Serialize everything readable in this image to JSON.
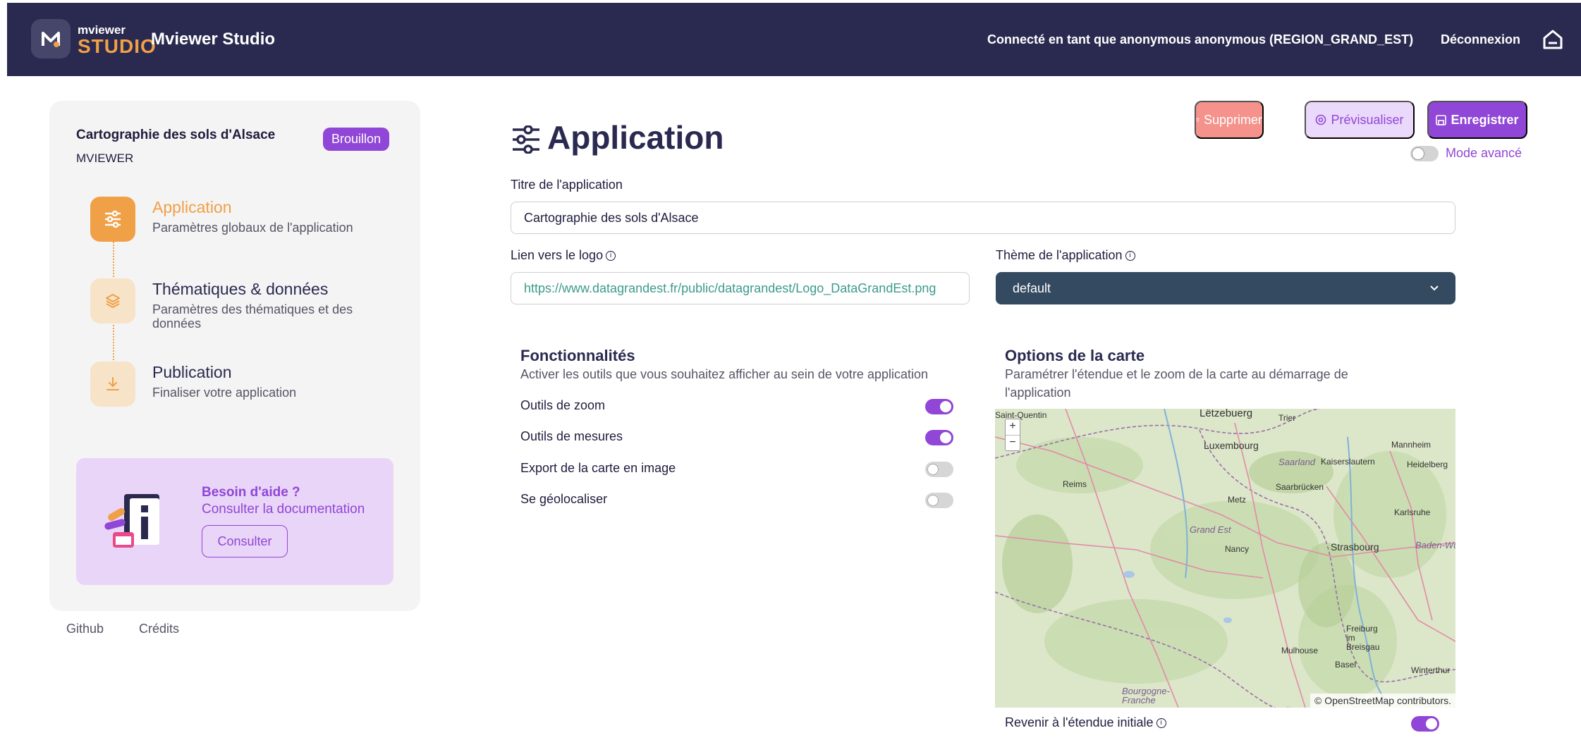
{
  "header": {
    "logo_small": "mviewer",
    "logo_big": "STUDIO",
    "app_name": "Mviewer Studio",
    "connected_as": "Connecté en tant que anonymous anonymous (REGION_GRAND_EST)",
    "logout": "Déconnexion",
    "home_icon": "home-icon"
  },
  "sidebar": {
    "project_title": "Cartographie des sols d'Alsace",
    "project_type": "MVIEWER",
    "status_badge": "Brouillon",
    "steps": [
      {
        "title": "Application",
        "description": "Paramètres globaux de l'application",
        "icon": "sliders-icon",
        "active": true
      },
      {
        "title": "Thématiques & données",
        "description": "Paramètres des thématiques et des données",
        "icon": "layers-icon",
        "active": false
      },
      {
        "title": "Publication",
        "description": "Finaliser votre application",
        "icon": "download-icon",
        "active": false
      }
    ],
    "help": {
      "title": "Besoin d'aide ?",
      "subtitle": "Consulter la documentation",
      "button": "Consulter"
    },
    "footer_links": [
      "Github",
      "Crédits"
    ]
  },
  "main": {
    "page_title": "Application",
    "actions": {
      "delete": "Supprimer",
      "preview": "Prévisualiser",
      "save": "Enregistrer"
    },
    "advanced_mode": {
      "label": "Mode avancé",
      "enabled": false
    },
    "form": {
      "title_label": "Titre de l'application",
      "title_value": "Cartographie des sols d'Alsace",
      "logo_label": "Lien vers le logo",
      "logo_value": "https://www.datagrandest.fr/public/datagrandest/Logo_DataGrandEst.png",
      "theme_label": "Thème de l'application",
      "theme_value": "default"
    },
    "features": {
      "title": "Fonctionnalités",
      "description": "Activer les outils que vous souhaitez afficher au sein de votre application",
      "items": [
        {
          "label": "Outils de zoom",
          "enabled": true
        },
        {
          "label": "Outils de mesures",
          "enabled": true
        },
        {
          "label": "Export de la carte en image",
          "enabled": false
        },
        {
          "label": "Se géolocaliser",
          "enabled": false
        }
      ]
    },
    "map_options": {
      "title": "Options de la carte",
      "description": "Paramétrer l'étendue et le zoom de la carte au démarrage de l'application",
      "zoom_in": "+",
      "zoom_out": "−",
      "cities": [
        "Saint-Quentin",
        "Lëtzebuerg",
        "Trier",
        "Luxembourg",
        "Mannheim",
        "Saarland",
        "Kaiserslautern",
        "Heidelberg",
        "Reims",
        "Saarbrücken",
        "Metz",
        "Karlsruhe",
        "Nancy",
        "Strasbourg",
        "Baden-Wü",
        "Freiburg im Breisgau",
        "Mulhouse",
        "Basel",
        "Winterthur",
        "Grand Est",
        "Bourgogne-Franche"
      ],
      "attribution": "© OpenStreetMap contributors.",
      "reset_extent_label": "Revenir à l'étendue initiale",
      "reset_extent_enabled": true
    }
  },
  "colors": {
    "header_bg": "#2a2a50",
    "accent_purple": "#9046d6",
    "accent_orange": "#f0a046",
    "delete_red": "#f4928b",
    "theme_select_bg": "#344a60"
  }
}
